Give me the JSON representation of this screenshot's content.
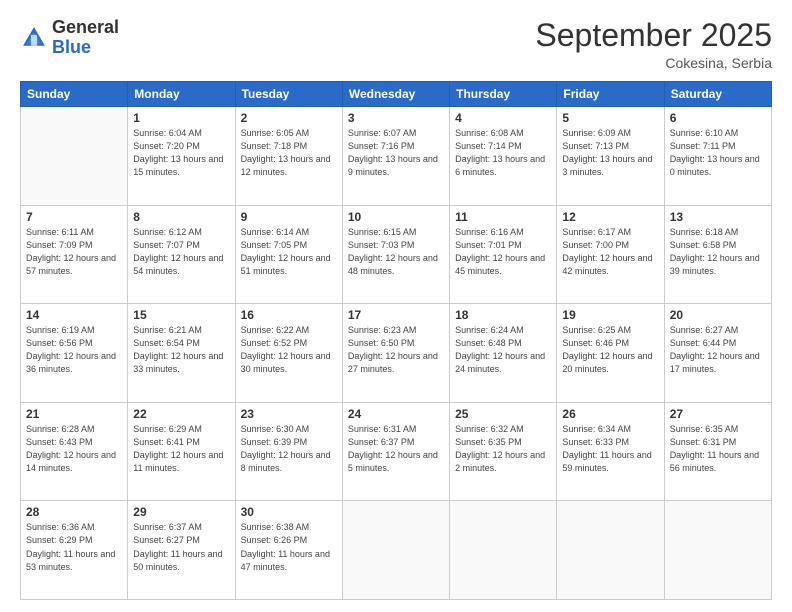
{
  "header": {
    "logo_general": "General",
    "logo_blue": "Blue",
    "month_title": "September 2025",
    "location": "Cokesina, Serbia"
  },
  "days_of_week": [
    "Sunday",
    "Monday",
    "Tuesday",
    "Wednesday",
    "Thursday",
    "Friday",
    "Saturday"
  ],
  "weeks": [
    [
      {
        "day": "",
        "empty": true
      },
      {
        "day": "1",
        "sunrise": "Sunrise: 6:04 AM",
        "sunset": "Sunset: 7:20 PM",
        "daylight": "Daylight: 13 hours and 15 minutes."
      },
      {
        "day": "2",
        "sunrise": "Sunrise: 6:05 AM",
        "sunset": "Sunset: 7:18 PM",
        "daylight": "Daylight: 13 hours and 12 minutes."
      },
      {
        "day": "3",
        "sunrise": "Sunrise: 6:07 AM",
        "sunset": "Sunset: 7:16 PM",
        "daylight": "Daylight: 13 hours and 9 minutes."
      },
      {
        "day": "4",
        "sunrise": "Sunrise: 6:08 AM",
        "sunset": "Sunset: 7:14 PM",
        "daylight": "Daylight: 13 hours and 6 minutes."
      },
      {
        "day": "5",
        "sunrise": "Sunrise: 6:09 AM",
        "sunset": "Sunset: 7:13 PM",
        "daylight": "Daylight: 13 hours and 3 minutes."
      },
      {
        "day": "6",
        "sunrise": "Sunrise: 6:10 AM",
        "sunset": "Sunset: 7:11 PM",
        "daylight": "Daylight: 13 hours and 0 minutes."
      }
    ],
    [
      {
        "day": "7",
        "sunrise": "Sunrise: 6:11 AM",
        "sunset": "Sunset: 7:09 PM",
        "daylight": "Daylight: 12 hours and 57 minutes."
      },
      {
        "day": "8",
        "sunrise": "Sunrise: 6:12 AM",
        "sunset": "Sunset: 7:07 PM",
        "daylight": "Daylight: 12 hours and 54 minutes."
      },
      {
        "day": "9",
        "sunrise": "Sunrise: 6:14 AM",
        "sunset": "Sunset: 7:05 PM",
        "daylight": "Daylight: 12 hours and 51 minutes."
      },
      {
        "day": "10",
        "sunrise": "Sunrise: 6:15 AM",
        "sunset": "Sunset: 7:03 PM",
        "daylight": "Daylight: 12 hours and 48 minutes."
      },
      {
        "day": "11",
        "sunrise": "Sunrise: 6:16 AM",
        "sunset": "Sunset: 7:01 PM",
        "daylight": "Daylight: 12 hours and 45 minutes."
      },
      {
        "day": "12",
        "sunrise": "Sunrise: 6:17 AM",
        "sunset": "Sunset: 7:00 PM",
        "daylight": "Daylight: 12 hours and 42 minutes."
      },
      {
        "day": "13",
        "sunrise": "Sunrise: 6:18 AM",
        "sunset": "Sunset: 6:58 PM",
        "daylight": "Daylight: 12 hours and 39 minutes."
      }
    ],
    [
      {
        "day": "14",
        "sunrise": "Sunrise: 6:19 AM",
        "sunset": "Sunset: 6:56 PM",
        "daylight": "Daylight: 12 hours and 36 minutes."
      },
      {
        "day": "15",
        "sunrise": "Sunrise: 6:21 AM",
        "sunset": "Sunset: 6:54 PM",
        "daylight": "Daylight: 12 hours and 33 minutes."
      },
      {
        "day": "16",
        "sunrise": "Sunrise: 6:22 AM",
        "sunset": "Sunset: 6:52 PM",
        "daylight": "Daylight: 12 hours and 30 minutes."
      },
      {
        "day": "17",
        "sunrise": "Sunrise: 6:23 AM",
        "sunset": "Sunset: 6:50 PM",
        "daylight": "Daylight: 12 hours and 27 minutes."
      },
      {
        "day": "18",
        "sunrise": "Sunrise: 6:24 AM",
        "sunset": "Sunset: 6:48 PM",
        "daylight": "Daylight: 12 hours and 24 minutes."
      },
      {
        "day": "19",
        "sunrise": "Sunrise: 6:25 AM",
        "sunset": "Sunset: 6:46 PM",
        "daylight": "Daylight: 12 hours and 20 minutes."
      },
      {
        "day": "20",
        "sunrise": "Sunrise: 6:27 AM",
        "sunset": "Sunset: 6:44 PM",
        "daylight": "Daylight: 12 hours and 17 minutes."
      }
    ],
    [
      {
        "day": "21",
        "sunrise": "Sunrise: 6:28 AM",
        "sunset": "Sunset: 6:43 PM",
        "daylight": "Daylight: 12 hours and 14 minutes."
      },
      {
        "day": "22",
        "sunrise": "Sunrise: 6:29 AM",
        "sunset": "Sunset: 6:41 PM",
        "daylight": "Daylight: 12 hours and 11 minutes."
      },
      {
        "day": "23",
        "sunrise": "Sunrise: 6:30 AM",
        "sunset": "Sunset: 6:39 PM",
        "daylight": "Daylight: 12 hours and 8 minutes."
      },
      {
        "day": "24",
        "sunrise": "Sunrise: 6:31 AM",
        "sunset": "Sunset: 6:37 PM",
        "daylight": "Daylight: 12 hours and 5 minutes."
      },
      {
        "day": "25",
        "sunrise": "Sunrise: 6:32 AM",
        "sunset": "Sunset: 6:35 PM",
        "daylight": "Daylight: 12 hours and 2 minutes."
      },
      {
        "day": "26",
        "sunrise": "Sunrise: 6:34 AM",
        "sunset": "Sunset: 6:33 PM",
        "daylight": "Daylight: 11 hours and 59 minutes."
      },
      {
        "day": "27",
        "sunrise": "Sunrise: 6:35 AM",
        "sunset": "Sunset: 6:31 PM",
        "daylight": "Daylight: 11 hours and 56 minutes."
      }
    ],
    [
      {
        "day": "28",
        "sunrise": "Sunrise: 6:36 AM",
        "sunset": "Sunset: 6:29 PM",
        "daylight": "Daylight: 11 hours and 53 minutes."
      },
      {
        "day": "29",
        "sunrise": "Sunrise: 6:37 AM",
        "sunset": "Sunset: 6:27 PM",
        "daylight": "Daylight: 11 hours and 50 minutes."
      },
      {
        "day": "30",
        "sunrise": "Sunrise: 6:38 AM",
        "sunset": "Sunset: 6:26 PM",
        "daylight": "Daylight: 11 hours and 47 minutes."
      },
      {
        "day": "",
        "empty": true
      },
      {
        "day": "",
        "empty": true
      },
      {
        "day": "",
        "empty": true
      },
      {
        "day": "",
        "empty": true
      }
    ]
  ]
}
